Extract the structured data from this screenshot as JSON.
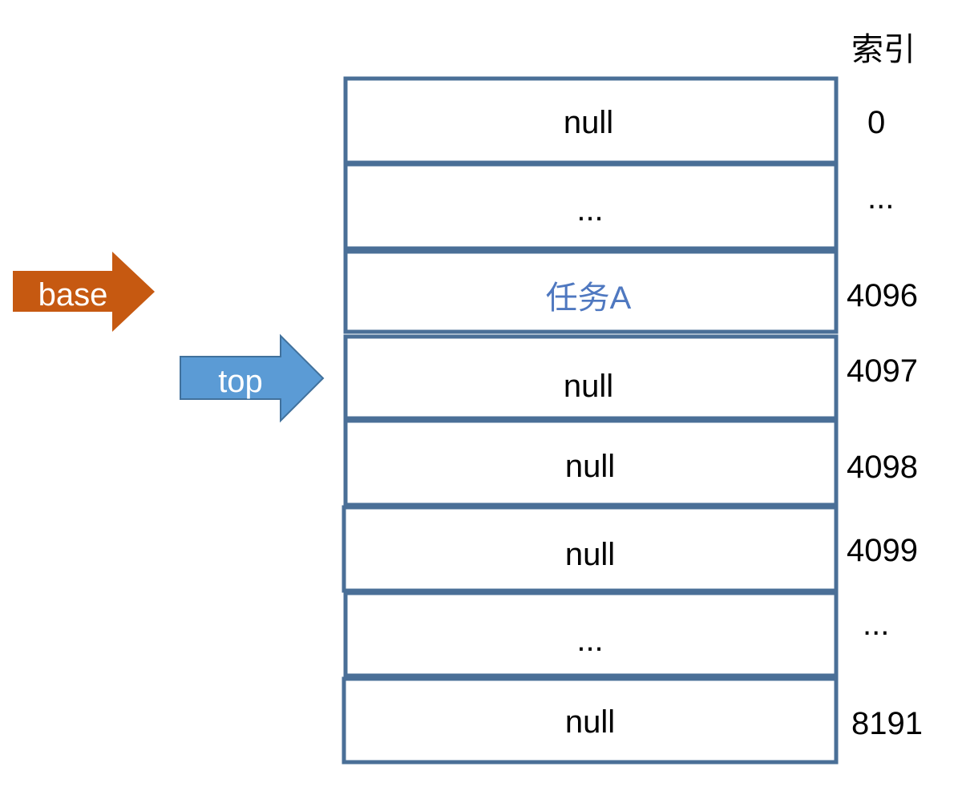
{
  "index_header": "索引",
  "colors": {
    "cell_border": "#4a6f97",
    "highlight_text": "#4f78c0",
    "base_arrow": "#c65911",
    "top_arrow": "#5b9bd5"
  },
  "pointers": [
    {
      "label": "base",
      "color": "#c65911",
      "points_to_index": "4096"
    },
    {
      "label": "top",
      "color": "#5b9bd5",
      "points_to_index": "4097"
    }
  ],
  "cells": [
    {
      "value": "null",
      "index": "0"
    },
    {
      "value": "...",
      "index": "..."
    },
    {
      "value": "任务A",
      "index": "4096",
      "highlight": true
    },
    {
      "value": "null",
      "index": "4097"
    },
    {
      "value": "null",
      "index": "4098"
    },
    {
      "value": "null",
      "index": "4099"
    },
    {
      "value": "...",
      "index": "..."
    },
    {
      "value": "null",
      "index": "8191"
    }
  ]
}
